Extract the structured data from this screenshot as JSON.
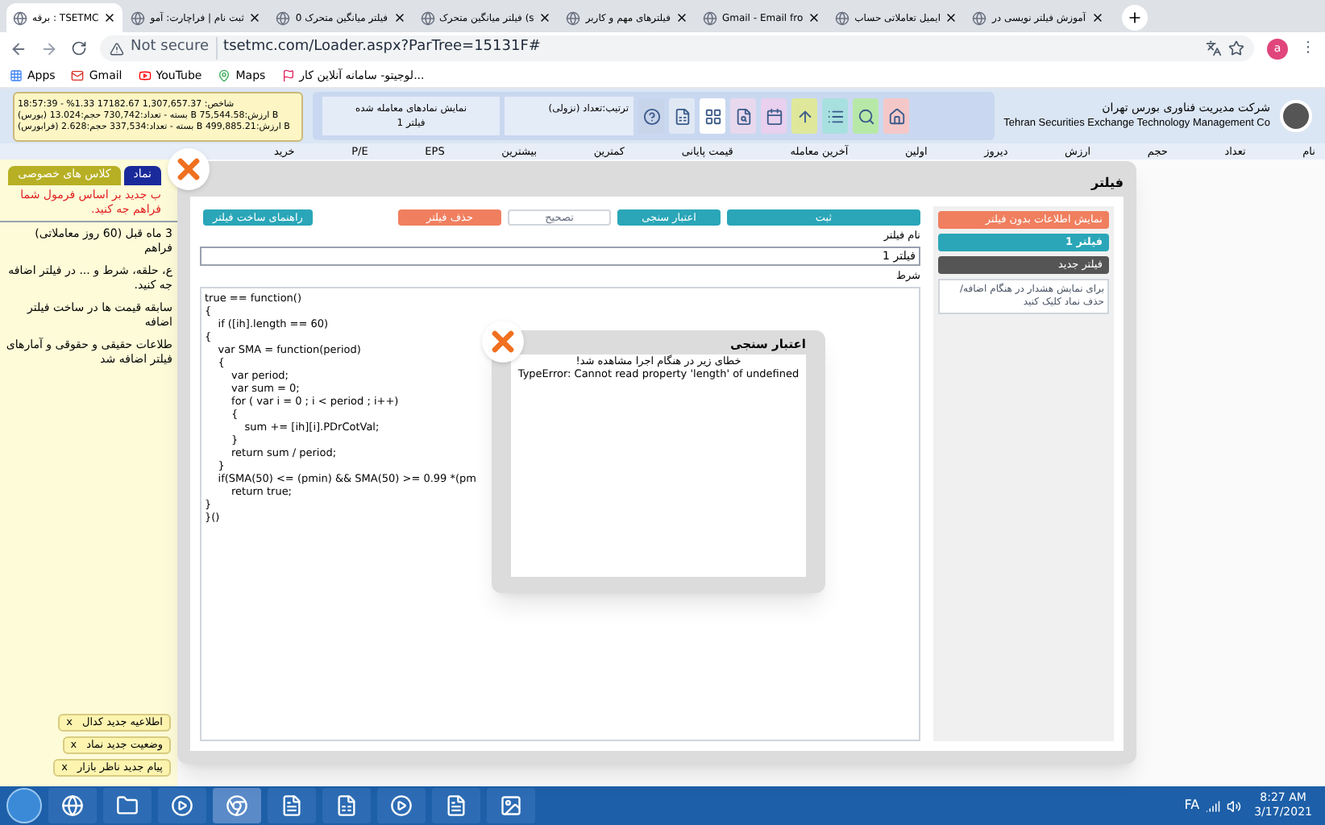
{
  "browser": {
    "tabs": [
      {
        "title": "آموزش فیلتر نویسی در",
        "selected": false
      },
      {
        "title": "ایمیل تعاملاتی حساب",
        "selected": false
      },
      {
        "title": "Gmail - Email fro",
        "selected": false
      },
      {
        "title": "فیلترهای مهم و کاربر",
        "selected": false
      },
      {
        "title": "فیلتر میانگین متحرک (s",
        "selected": false
      },
      {
        "title": "فیلتر میانگین متحرک 0",
        "selected": false
      },
      {
        "title": "ثبت نام | فراچارت: آمو",
        "selected": false
      },
      {
        "title": "برقه : TSETMC",
        "selected": true
      }
    ],
    "security": "Not secure",
    "url": "tsetmc.com/Loader.aspx?ParTree=15131F#",
    "bookmarks": [
      "لوجیتو- سامانه آنلاین کار...",
      "Maps",
      "YouTube",
      "Gmail",
      "Apps"
    ],
    "profile": "a",
    "menu": "⋮"
  },
  "site": {
    "ticker": [
      "18:57:39 - %1.33 17182.67 1,307,657.37 :شاخص",
      "(بورس) بسته - تعداد:730,742 حجم:13.024 B ارزش:75,544.58 B",
      "(فرابورس) بسته - تعداد:337,534 حجم:2.628 B ارزش:499,885.21 B"
    ],
    "sort": "ترتیب:تعداد (نزولی)",
    "filter_info": [
      "نمایش نمادهای معامله شده",
      "فیلتر 1"
    ],
    "company_fa": "شرکت مدیریت فناوری بورس تهران",
    "company_en": "Tehran Securities Exchange Technology Management Co"
  },
  "table": {
    "columns": [
      "نام",
      "تعداد",
      "حجم",
      "ارزش",
      "دیروز",
      "اولین",
      "آخرین معامله",
      "قیمت پایانی",
      "کمترین",
      "بیشترین",
      "EPS",
      "P/E",
      "خرید"
    ]
  },
  "side_panel": {
    "tabs": [
      {
        "label": "نماد",
        "selected": true
      },
      {
        "label": "کلاس های خصوصی",
        "selected": false
      }
    ],
    "alert": "ب جدید بر اساس فرمول شما فراهم جه کنید.",
    "news": [
      "3 ماه قبل (60 روز معاملاتی) فراهم",
      "ع، حلقه، شرط و ... در فیلتر اضافه جه کنید.",
      "سابقه قیمت ها در ساخت فیلتر اضافه",
      "طلاعات حقیقی و حقوقی و آمارهای فیلتر اضافه شد"
    ],
    "notifications": [
      {
        "label": "اطلاعیه جدید کدال",
        "close": "x"
      },
      {
        "label": "وضعیت جدید نماد",
        "close": "x"
      },
      {
        "label": "پیام جدید ناظر بازار",
        "close": "x"
      }
    ]
  },
  "filter_dialog": {
    "title": "فیلتر",
    "filters": [
      {
        "label": "نمایش اطلاعات بدون فیلتر",
        "kind": "reset",
        "selected": false
      },
      {
        "label": "فیلتر 1",
        "kind": "saved",
        "selected": true
      },
      {
        "label": "فیلتر جدید",
        "kind": "new",
        "selected": false
      }
    ],
    "hint": "برای نمایش هشدار در هنگام اضافه/حذف نماد کلیک کنید",
    "buttons": [
      {
        "label": "ثبت",
        "kind": "primary"
      },
      {
        "label": "اعتبار سنجی",
        "kind": "primary"
      },
      {
        "label": "تصحیح",
        "kind": "plain"
      },
      {
        "label": "حذف فیلتر",
        "kind": "danger"
      }
    ],
    "guide": "راهنمای ساخت فیلتر",
    "name_label": "نام فیلتر",
    "name_value": "فیلتر 1",
    "condition_label": "شرط",
    "code": [
      "true == function()",
      "{",
      "\tif ([ih].length == 60)",
      "{",
      "\tvar SMA = function(period)",
      "\t{",
      "\t\tvar period;",
      "\t\tvar sum = 0;",
      "\t\tfor ( var i = 0 ; i < period ; i++)",
      "\t\t{",
      "\t\t\tsum += [ih][i].PDrCotVal;",
      "\t\t}",
      "\t\treturn sum / period;",
      "\t}",
      "\tif(SMA(50) <= (pmin) && SMA(50) >= 0.99 *(pm",
      "\t\treturn true;",
      "}",
      "}()"
    ]
  },
  "error_dialog": {
    "title": "اعتبار سنجی",
    "message": "خطای زیر در هنگام اجرا مشاهده شد!",
    "error": "TypeError: Cannot read property 'length' of undefined"
  },
  "taskbar": {
    "language": "FA",
    "time": "8:27 AM",
    "date": "3/17/2021"
  }
}
